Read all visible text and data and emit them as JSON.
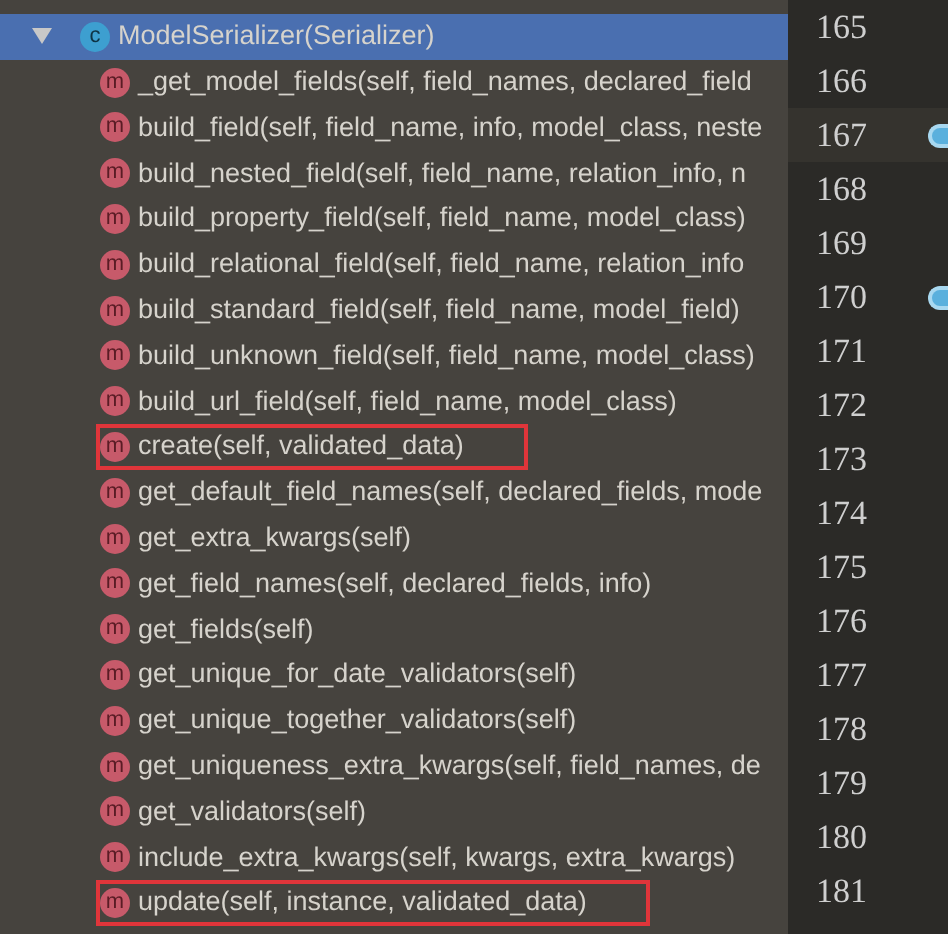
{
  "structure_tree": [
    {
      "kind": "class",
      "badge": "c",
      "label": "ModelSerializer(Serializer)",
      "expanded": true,
      "selected": true,
      "children": [
        {
          "kind": "method",
          "badge": "m",
          "label": "_get_model_fields(self, field_names, declared_field",
          "selected": false,
          "boxed": false
        },
        {
          "kind": "method",
          "badge": "m",
          "label": "build_field(self, field_name, info, model_class, neste",
          "selected": false,
          "boxed": false
        },
        {
          "kind": "method",
          "badge": "m",
          "label": "build_nested_field(self, field_name, relation_info, n",
          "selected": false,
          "boxed": false
        },
        {
          "kind": "method",
          "badge": "m",
          "label": "build_property_field(self, field_name, model_class)",
          "selected": false,
          "boxed": false
        },
        {
          "kind": "method",
          "badge": "m",
          "label": "build_relational_field(self, field_name, relation_info",
          "selected": false,
          "boxed": false
        },
        {
          "kind": "method",
          "badge": "m",
          "label": "build_standard_field(self, field_name, model_field)",
          "selected": false,
          "boxed": false
        },
        {
          "kind": "method",
          "badge": "m",
          "label": "build_unknown_field(self, field_name, model_class)",
          "selected": false,
          "boxed": false
        },
        {
          "kind": "method",
          "badge": "m",
          "label": "build_url_field(self, field_name, model_class)",
          "selected": false,
          "boxed": false
        },
        {
          "kind": "method",
          "badge": "m",
          "label": "create(self, validated_data)",
          "selected": false,
          "boxed": true
        },
        {
          "kind": "method",
          "badge": "m",
          "label": "get_default_field_names(self, declared_fields, mode",
          "selected": false,
          "boxed": false
        },
        {
          "kind": "method",
          "badge": "m",
          "label": "get_extra_kwargs(self)",
          "selected": false,
          "boxed": false
        },
        {
          "kind": "method",
          "badge": "m",
          "label": "get_field_names(self, declared_fields, info)",
          "selected": false,
          "boxed": false
        },
        {
          "kind": "method",
          "badge": "m",
          "label": "get_fields(self)",
          "selected": false,
          "boxed": false
        },
        {
          "kind": "method",
          "badge": "m",
          "label": "get_unique_for_date_validators(self)",
          "selected": false,
          "boxed": false
        },
        {
          "kind": "method",
          "badge": "m",
          "label": "get_unique_together_validators(self)",
          "selected": false,
          "boxed": false
        },
        {
          "kind": "method",
          "badge": "m",
          "label": "get_uniqueness_extra_kwargs(self, field_names, de",
          "selected": false,
          "boxed": false
        },
        {
          "kind": "method",
          "badge": "m",
          "label": "get_validators(self)",
          "selected": false,
          "boxed": false
        },
        {
          "kind": "method",
          "badge": "m",
          "label": "include_extra_kwargs(self, kwargs, extra_kwargs)",
          "selected": false,
          "boxed": false
        },
        {
          "kind": "method",
          "badge": "m",
          "label": "update(self, instance, validated_data)",
          "selected": false,
          "boxed": true
        }
      ]
    }
  ],
  "gutter": [
    {
      "number": "165",
      "current": false,
      "marker": false
    },
    {
      "number": "166",
      "current": false,
      "marker": false
    },
    {
      "number": "167",
      "current": true,
      "marker": true
    },
    {
      "number": "168",
      "current": false,
      "marker": false
    },
    {
      "number": "169",
      "current": false,
      "marker": false
    },
    {
      "number": "170",
      "current": false,
      "marker": true
    },
    {
      "number": "171",
      "current": false,
      "marker": false
    },
    {
      "number": "172",
      "current": false,
      "marker": false
    },
    {
      "number": "173",
      "current": false,
      "marker": false
    },
    {
      "number": "174",
      "current": false,
      "marker": false
    },
    {
      "number": "175",
      "current": false,
      "marker": false
    },
    {
      "number": "176",
      "current": false,
      "marker": false
    },
    {
      "number": "177",
      "current": false,
      "marker": false
    },
    {
      "number": "178",
      "current": false,
      "marker": false
    },
    {
      "number": "179",
      "current": false,
      "marker": false
    },
    {
      "number": "180",
      "current": false,
      "marker": false
    },
    {
      "number": "181",
      "current": false,
      "marker": false
    }
  ]
}
